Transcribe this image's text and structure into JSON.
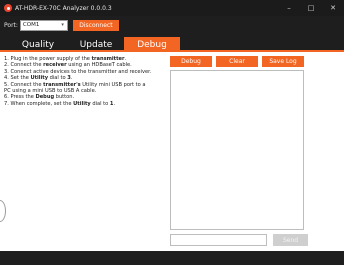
{
  "window": {
    "title": "AT-HDR-EX-70C Analyzer 0.0.0.3",
    "minimize_glyph": "–",
    "maximize_glyph": "□",
    "close_glyph": "✕"
  },
  "port": {
    "label": "Port:",
    "selected": "COM1",
    "disconnect_label": "Disconnect"
  },
  "tabs": [
    {
      "label": "Quality"
    },
    {
      "label": "Update"
    },
    {
      "label": "Debug",
      "active": true
    }
  ],
  "instructions": [
    {
      "pre": "1. Plug in the power supply of the ",
      "bold": "transmitter",
      "post": "."
    },
    {
      "pre": "2. Connect the ",
      "bold": "receiver",
      "post": " using an HDBaseT cable."
    },
    {
      "pre": "3. Conenct active devices to the transmitter and receiver.",
      "bold": "",
      "post": ""
    },
    {
      "pre": "4. Set the ",
      "bold": "Utility",
      "post": " dial to ",
      "bold2": "3",
      "post2": "."
    },
    {
      "pre": "5. Connect the ",
      "bold": "transmitter's",
      "post": " Utility mini USB port to a"
    },
    {
      "pre": "    PC using a mini USB to USB A cable.",
      "bold": "",
      "post": ""
    },
    {
      "pre": "6. Press the ",
      "bold": "Debug",
      "post": " button."
    },
    {
      "pre": "7. When complete, set the ",
      "bold": "Utility",
      "post": " dial to ",
      "bold2": "1",
      "post2": "."
    }
  ],
  "buttons": {
    "debug": "Debug",
    "clear": "Clear",
    "save_log": "Save Log",
    "send": "Send"
  },
  "send_input": {
    "value": "",
    "placeholder": ""
  },
  "colors": {
    "accent": "#f26522",
    "chrome": "#1e1e1e"
  }
}
